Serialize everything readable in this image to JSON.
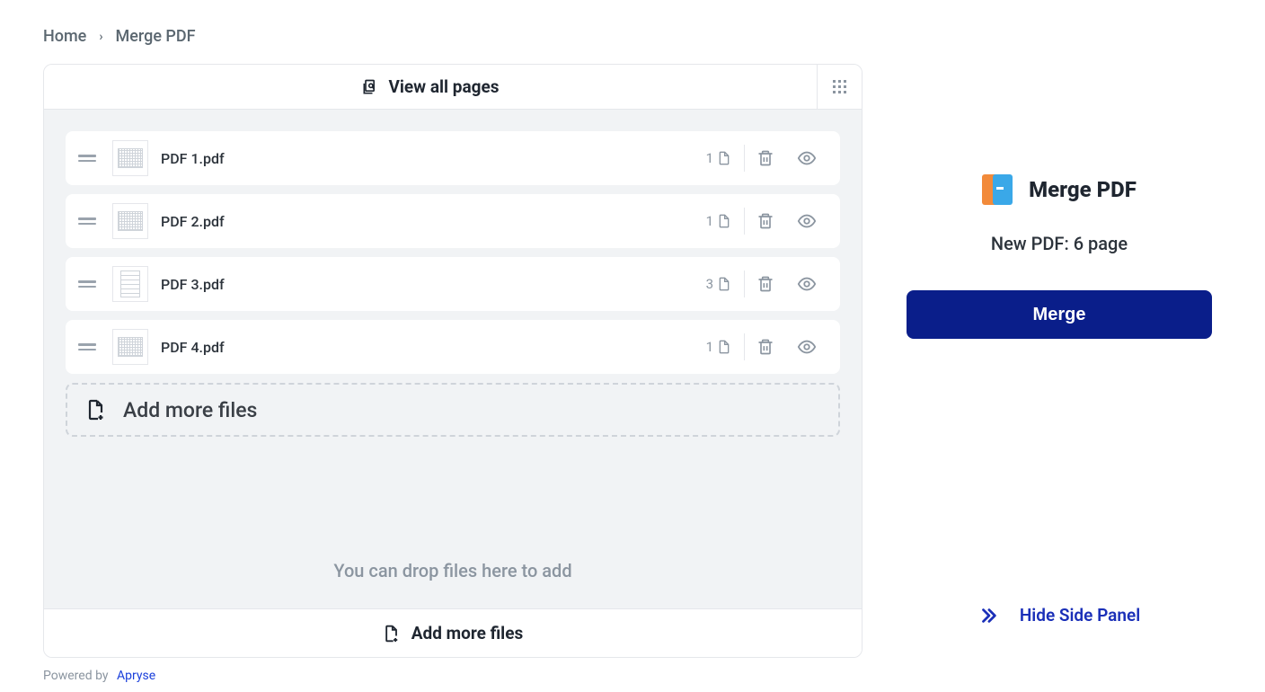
{
  "breadcrumb": {
    "home": "Home",
    "current": "Merge PDF"
  },
  "header": {
    "view_all": "View all pages"
  },
  "files": [
    {
      "name": "PDF 1.pdf",
      "pages": "1",
      "portrait": false
    },
    {
      "name": "PDF 2.pdf",
      "pages": "1",
      "portrait": false
    },
    {
      "name": "PDF 3.pdf",
      "pages": "3",
      "portrait": true
    },
    {
      "name": "PDF 4.pdf",
      "pages": "1",
      "portrait": false
    }
  ],
  "add_more_inline": "Add more files",
  "drop_hint": "You can drop files here to add",
  "footer_add_more": "Add more files",
  "side": {
    "title": "Merge PDF",
    "summary": "New PDF: 6 page",
    "merge_btn": "Merge",
    "hide": "Hide Side Panel"
  },
  "powered": {
    "prefix": "Powered by",
    "name": "Apryse"
  }
}
